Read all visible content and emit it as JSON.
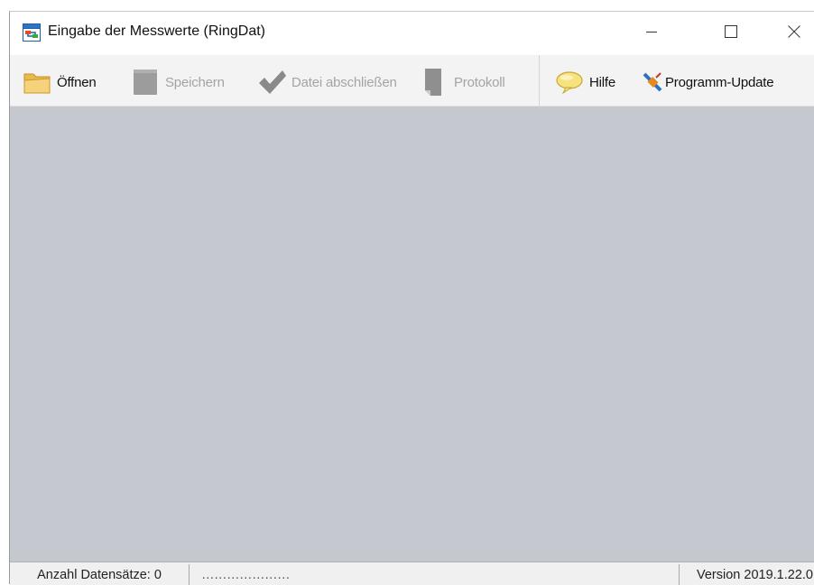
{
  "window": {
    "title": "Eingabe der Messwerte (RingDat)",
    "controls": {
      "minimize": "minimize",
      "maximize": "maximize",
      "close": "close"
    }
  },
  "toolbar": {
    "items": [
      {
        "label": "Öffnen",
        "icon": "folder-icon",
        "enabled": true
      },
      {
        "label": "Speichern",
        "icon": "save-icon",
        "enabled": false
      },
      {
        "label": "Datei abschließen",
        "icon": "checkmark-icon",
        "enabled": false
      },
      {
        "label": "Protokoll",
        "icon": "document-icon",
        "enabled": false
      },
      {
        "label": "Hilfe",
        "icon": "speech-bubble-icon",
        "enabled": true
      },
      {
        "label": "Programm-Update",
        "icon": "satellite-icon",
        "enabled": true
      }
    ]
  },
  "client_area": {
    "background": "#c5c8cf"
  },
  "statusbar": {
    "record_count": "Anzahl Datensätze: 0",
    "progress": "…………………",
    "version": "Version 2019.1.22.0"
  }
}
